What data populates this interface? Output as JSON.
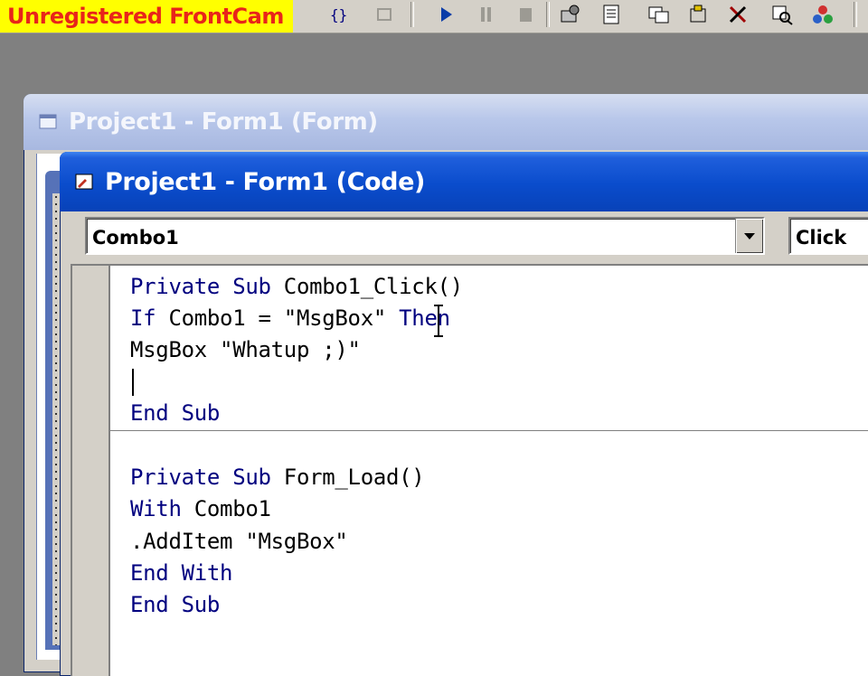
{
  "watermark": "Unregistered FrontCam",
  "toolbar": {
    "icons": [
      "break-icon",
      "run-icon",
      "pause-icon",
      "stop-icon",
      "project-explorer-icon",
      "properties-icon",
      "form-layout-icon",
      "object-browser-icon",
      "toolbox-icon",
      "data-view-icon",
      "component-icon"
    ]
  },
  "form_window": {
    "title": "Project1 - Form1 (Form)"
  },
  "code_window": {
    "title": "Project1 - Form1 (Code)",
    "object_combo": "Combo1",
    "procedure_combo": "Click"
  },
  "code": {
    "line1_kw": "Private Sub",
    "line1_rest": " Combo1_Click()",
    "line2_kw": "If",
    "line2_mid": " Combo1 = \"MsgBox\" ",
    "line2_kw2": "Then",
    "line3": "MsgBox \"Whatup ;)\"",
    "line5_kw": "End Sub",
    "line7_kw": "Private Sub",
    "line7_rest": " Form_Load()",
    "line8_kw": "With",
    "line8_rest": " Combo1",
    "line9": ".AddItem \"MsgBox\"",
    "line10_kw": "End With",
    "line11_kw": "End Sub"
  },
  "colors": {
    "keyword": "#00007f",
    "watermark_bg": "#ffff00",
    "watermark_text": "#e8251a",
    "active_title": "#0a4ccc",
    "inactive_title": "#b8c7ea"
  }
}
